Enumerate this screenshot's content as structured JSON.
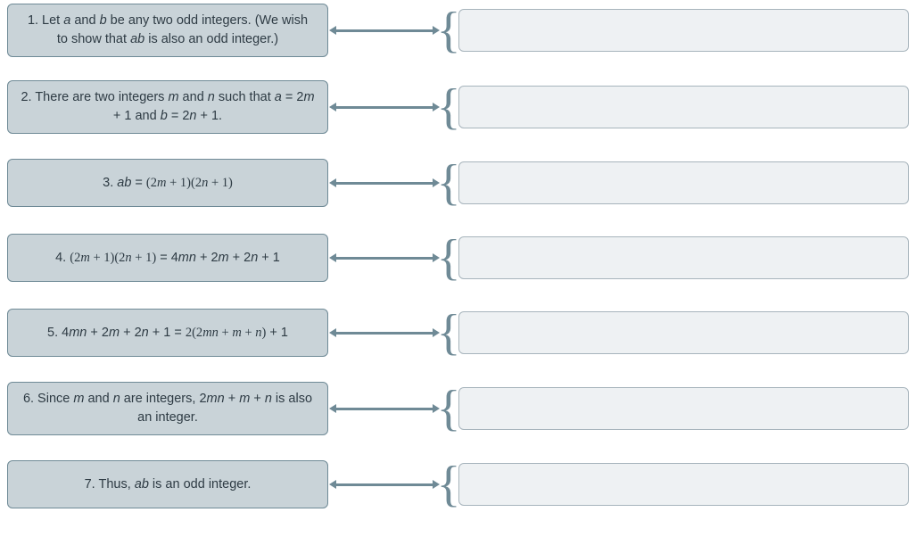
{
  "rows": [
    {
      "prefix": "1. Let ",
      "mid1": "a",
      "mid2": " and ",
      "mid3": "b",
      "mid4": " be any two odd integers. (We wish to show that ",
      "mid5": "ab",
      "suffix": " is also an odd integer.)"
    },
    {
      "prefix": "2. There are two integers ",
      "mid1": "m",
      "mid2": " and ",
      "mid3": "n",
      "mid4": "  such that ",
      "mid5": "a",
      "mid6": " = 2",
      "mid7": "m",
      "mid8": " + 1 and ",
      "mid9": "b",
      "mid10": " = 2",
      "mid11": "n",
      "suffix": " + 1."
    },
    {
      "prefix": "3. ",
      "mid1": "ab",
      "mid2": " = ",
      "serif1": "(2",
      "serif2": "m",
      "serif3": " + 1)(2",
      "serif4": "n",
      "serif5": " + 1)"
    },
    {
      "prefix": "4. ",
      "serif1": "(2",
      "serif2": "m",
      "serif3": " + 1)(2",
      "serif4": "n",
      "serif5": " + 1)",
      "mid1": " = 4",
      "mid2": "mn",
      "mid3": " + 2",
      "mid4": "m",
      "mid5": " + 2",
      "mid6": "n",
      "suffix": " + 1"
    },
    {
      "prefix": "5. 4",
      "mid1": "mn",
      "mid2": " + 2",
      "mid3": "m",
      "mid4": " + 2",
      "mid5": "n",
      "mid6": " + 1 = ",
      "serif1": "2(2",
      "serif2": "mn",
      "serif3": " + ",
      "serif4": "m",
      "serif5": " + ",
      "serif6": "n",
      "serif7": ")",
      "suffix": " + 1"
    },
    {
      "prefix": "6. Since ",
      "mid1": "m",
      "mid2": " and ",
      "mid3": "n",
      "mid4": " are integers, 2",
      "mid5": "mn",
      "mid6": " + ",
      "mid7": "m",
      "mid8": " + ",
      "mid9": "n",
      "suffix": " is also an integer."
    },
    {
      "prefix": "7. Thus, ",
      "mid1": "ab",
      "suffix": " is an odd integer."
    }
  ],
  "brace_char": "{"
}
